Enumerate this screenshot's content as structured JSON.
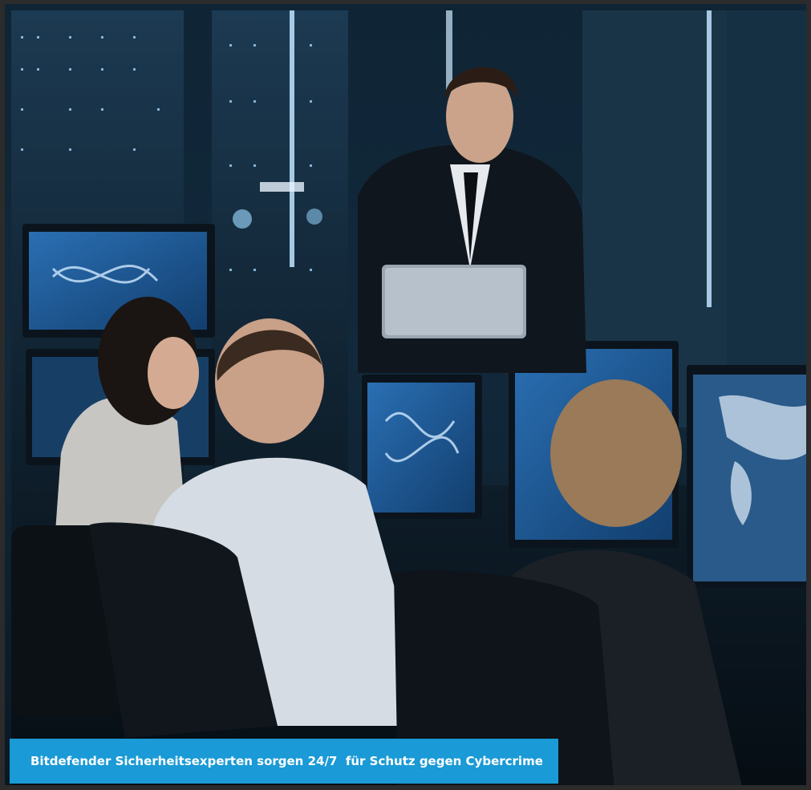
{
  "photo": {
    "subject": "security-operations-center-team",
    "palette": {
      "room": "#12293b",
      "screen_glow": "#3b8fd8",
      "accent_light": "#bfe4ff"
    }
  },
  "caption": {
    "text": "Bitdefender Sicherheitsexperten sorgen 24/7  für Schutz gegen Cybercrime",
    "background": "#1a9ad6",
    "color": "#ffffff"
  }
}
